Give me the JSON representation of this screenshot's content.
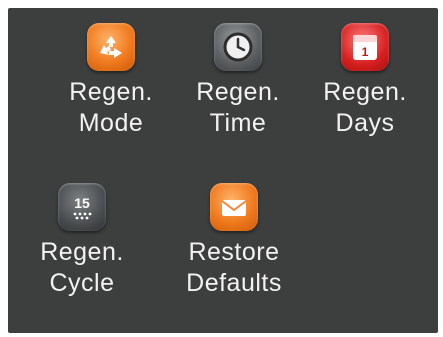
{
  "menu": {
    "items": [
      {
        "line1": "Regen.",
        "line2": "Mode",
        "icon": "recycle-icon",
        "color": "#f07a1e"
      },
      {
        "line1": "Regen.",
        "line2": "Time",
        "icon": "clock-icon",
        "color": "#5a5d60"
      },
      {
        "line1": "Regen.",
        "line2": "Days",
        "icon": "calendar-icon",
        "color": "#d62020",
        "calendar_number": "1"
      },
      {
        "line1": "Regen.",
        "line2": "Cycle",
        "icon": "cycle-counter-icon",
        "color": "#4a4d50",
        "counter_value": "15"
      },
      {
        "line1": "Restore",
        "line2": "Defaults",
        "icon": "envelope-icon",
        "color": "#f07a1e"
      }
    ]
  }
}
